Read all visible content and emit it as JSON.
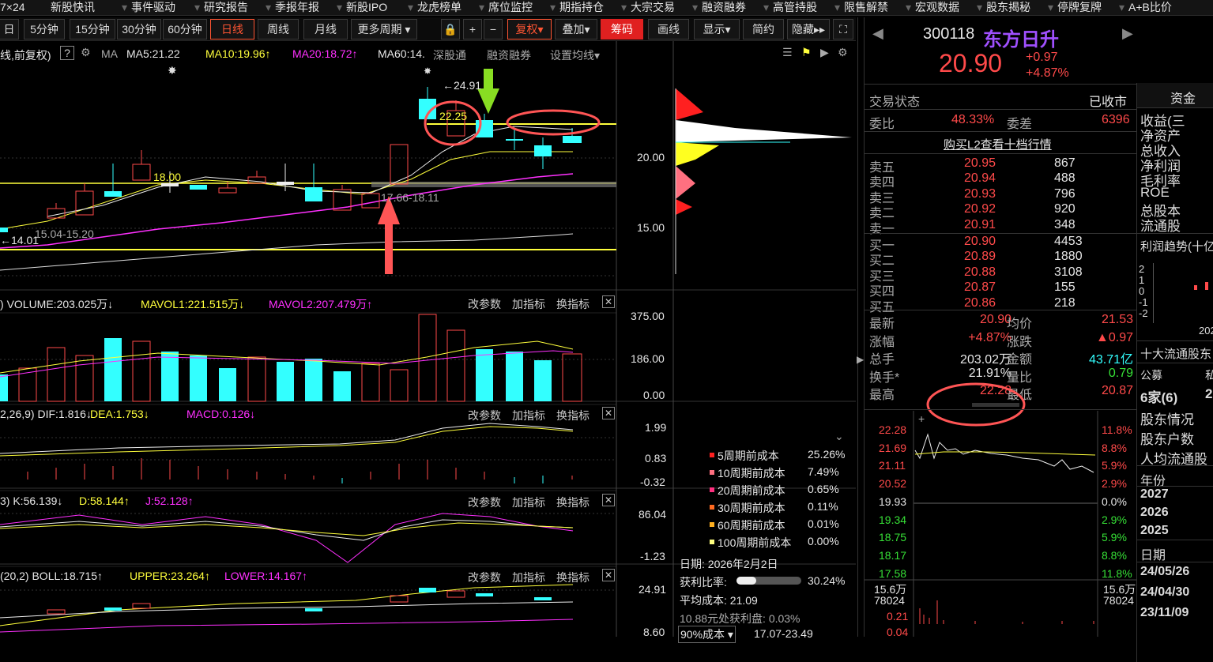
{
  "topnav": [
    "7×24",
    "新股快讯",
    "事件驱动",
    "研究报告",
    "季报年报",
    "新股IPO",
    "龙虎榜单",
    "席位监控",
    "期指持仓",
    "大宗交易",
    "融资融券",
    "高管持股",
    "限售解禁",
    "宏观数据",
    "股东揭秘",
    "停牌复牌",
    "A+B比价"
  ],
  "toolbar": {
    "periods": [
      "日",
      "5分钟",
      "15分钟",
      "30分钟",
      "60分钟",
      "日线",
      "周线",
      "月线",
      "更多周期"
    ],
    "buttons": [
      "复权",
      "叠加",
      "筹码",
      "画线",
      "显示",
      "简约",
      "隐藏"
    ]
  },
  "ma_bar": {
    "prefix": "线,前复权)",
    "ma": "MA",
    "ma5": "MA5:21.22",
    "ma10": "MA10:19.96",
    "ma20": "MA20:18.72",
    "ma60": "MA60:14.",
    "links": [
      "深股通",
      "融资融券",
      "设置均线"
    ]
  },
  "price_axis": [
    "20.00",
    "15.00"
  ],
  "annotations": {
    "high": "←24.91",
    "circle_price": "22.25",
    "p18": "18.00",
    "range1": "17.66-18.11",
    "range2": "15.04-15.20",
    "low": "←14.01"
  },
  "volume": {
    "title": "VOLUME:203.025万",
    "mavol1": "MAVOL1:221.515万",
    "mavol2": "MAVOL2:207.479万",
    "axis": [
      "375.00",
      "186.00",
      "0.00"
    ]
  },
  "macd": {
    "prefix": "2,26,9)",
    "dif": "DIF:1.816",
    "dea": "DEA:1.753",
    "macd": "MACD:0.126",
    "axis": [
      "1.99",
      "0.83",
      "-0.32"
    ]
  },
  "kdj": {
    "prefix": "3)",
    "k": "K:56.139",
    "d": "D:58.144",
    "j": "J:52.128",
    "axis": [
      "86.04",
      "-1.23"
    ]
  },
  "boll": {
    "prefix": "(20,2)",
    "boll": "BOLL:18.715",
    "upper": "UPPER:23.264",
    "lower": "LOWER:14.167",
    "axis": [
      "24.91",
      "8.60"
    ]
  },
  "panel_btns": [
    "改参数",
    "加指标",
    "换指标"
  ],
  "chip": {
    "legend": [
      {
        "label": "5周期前成本",
        "value": "25.26%",
        "color": "#ff2020"
      },
      {
        "label": "10周期前成本",
        "value": "7.49%",
        "color": "#ff7080"
      },
      {
        "label": "20周期前成本",
        "value": "0.65%",
        "color": "#ff3080"
      },
      {
        "label": "30周期前成本",
        "value": "0.11%",
        "color": "#ff6a20"
      },
      {
        "label": "60周期前成本",
        "value": "0.01%",
        "color": "#ffb020"
      },
      {
        "label": "100周期前成本",
        "value": "0.00%",
        "color": "#ffff80"
      }
    ],
    "date": "日期: 2026年2月2日",
    "profit_label": "获利比率:",
    "profit": "30.24%",
    "avg": "平均成本: 21.09",
    "profit_at": "10.88元处获利盘: 0.03%",
    "cost90": "90%成本",
    "cost90_range": "17.07-23.49"
  },
  "quote": {
    "code": "300118",
    "name": "东方日升",
    "price": "20.90",
    "chg": "+0.97",
    "pct": "+4.87%",
    "status_label": "交易状态",
    "status": "已收市",
    "tab": "资金",
    "webi_label": "委比",
    "webi": "48.33%",
    "weicha_label": "委差",
    "weicha": "6396",
    "l2": "购买L2查看十档行情",
    "sell": [
      [
        "卖五",
        "20.95",
        "867"
      ],
      [
        "卖四",
        "20.94",
        "488"
      ],
      [
        "卖三",
        "20.93",
        "796"
      ],
      [
        "卖二",
        "20.92",
        "920"
      ],
      [
        "卖一",
        "20.91",
        "348"
      ]
    ],
    "buy": [
      [
        "买一",
        "20.90",
        "4453"
      ],
      [
        "买二",
        "20.89",
        "1880"
      ],
      [
        "买三",
        "20.88",
        "3108"
      ],
      [
        "买四",
        "20.87",
        "155"
      ],
      [
        "买五",
        "20.86",
        "218"
      ]
    ],
    "stats": [
      [
        "最新",
        "20.90",
        "均价",
        "21.53"
      ],
      [
        "涨幅",
        "+4.87%",
        "涨跌",
        "▲0.97"
      ],
      [
        "总手",
        "203.02万",
        "金额",
        "43.71亿"
      ],
      [
        "换手*",
        "21.91%",
        "量比",
        "0.79"
      ],
      [
        "最高",
        "22.28",
        "最低",
        "20.87"
      ]
    ]
  },
  "intraday": {
    "left": [
      "22.28",
      "21.69",
      "21.11",
      "20.52",
      "19.93",
      "19.34",
      "18.75",
      "18.17",
      "17.58"
    ],
    "right": [
      "11.8%",
      "8.8%",
      "5.9%",
      "2.9%",
      "0.0%",
      "2.9%",
      "5.9%",
      "8.8%",
      "11.8%"
    ],
    "vol_left": [
      "15.6万",
      "78024"
    ],
    "vol_right": [
      "15.6万",
      "78024"
    ],
    "sub": [
      "0.21",
      "0.04"
    ]
  },
  "far_right": {
    "items": [
      "收益(三",
      "净资产",
      "总收入",
      "净利润",
      "毛利率",
      "ROE",
      "总股本",
      "流通股"
    ],
    "trend": "利润趋势(十亿",
    "axis": [
      "2",
      "1",
      "0",
      "-1",
      "-2"
    ],
    "yr": "202",
    "top10": "十大流通股东",
    "ann": "公募",
    "ann2": "私",
    "count": "6家(6)",
    "count2": "2",
    "links": [
      "股东情况",
      "股东户数",
      "人均流通股"
    ],
    "year_label": "年份",
    "years": [
      "2027",
      "2026",
      "2025"
    ],
    "date_label": "日期",
    "dates": [
      "24/05/26",
      "24/04/30",
      "23/11/09"
    ]
  }
}
